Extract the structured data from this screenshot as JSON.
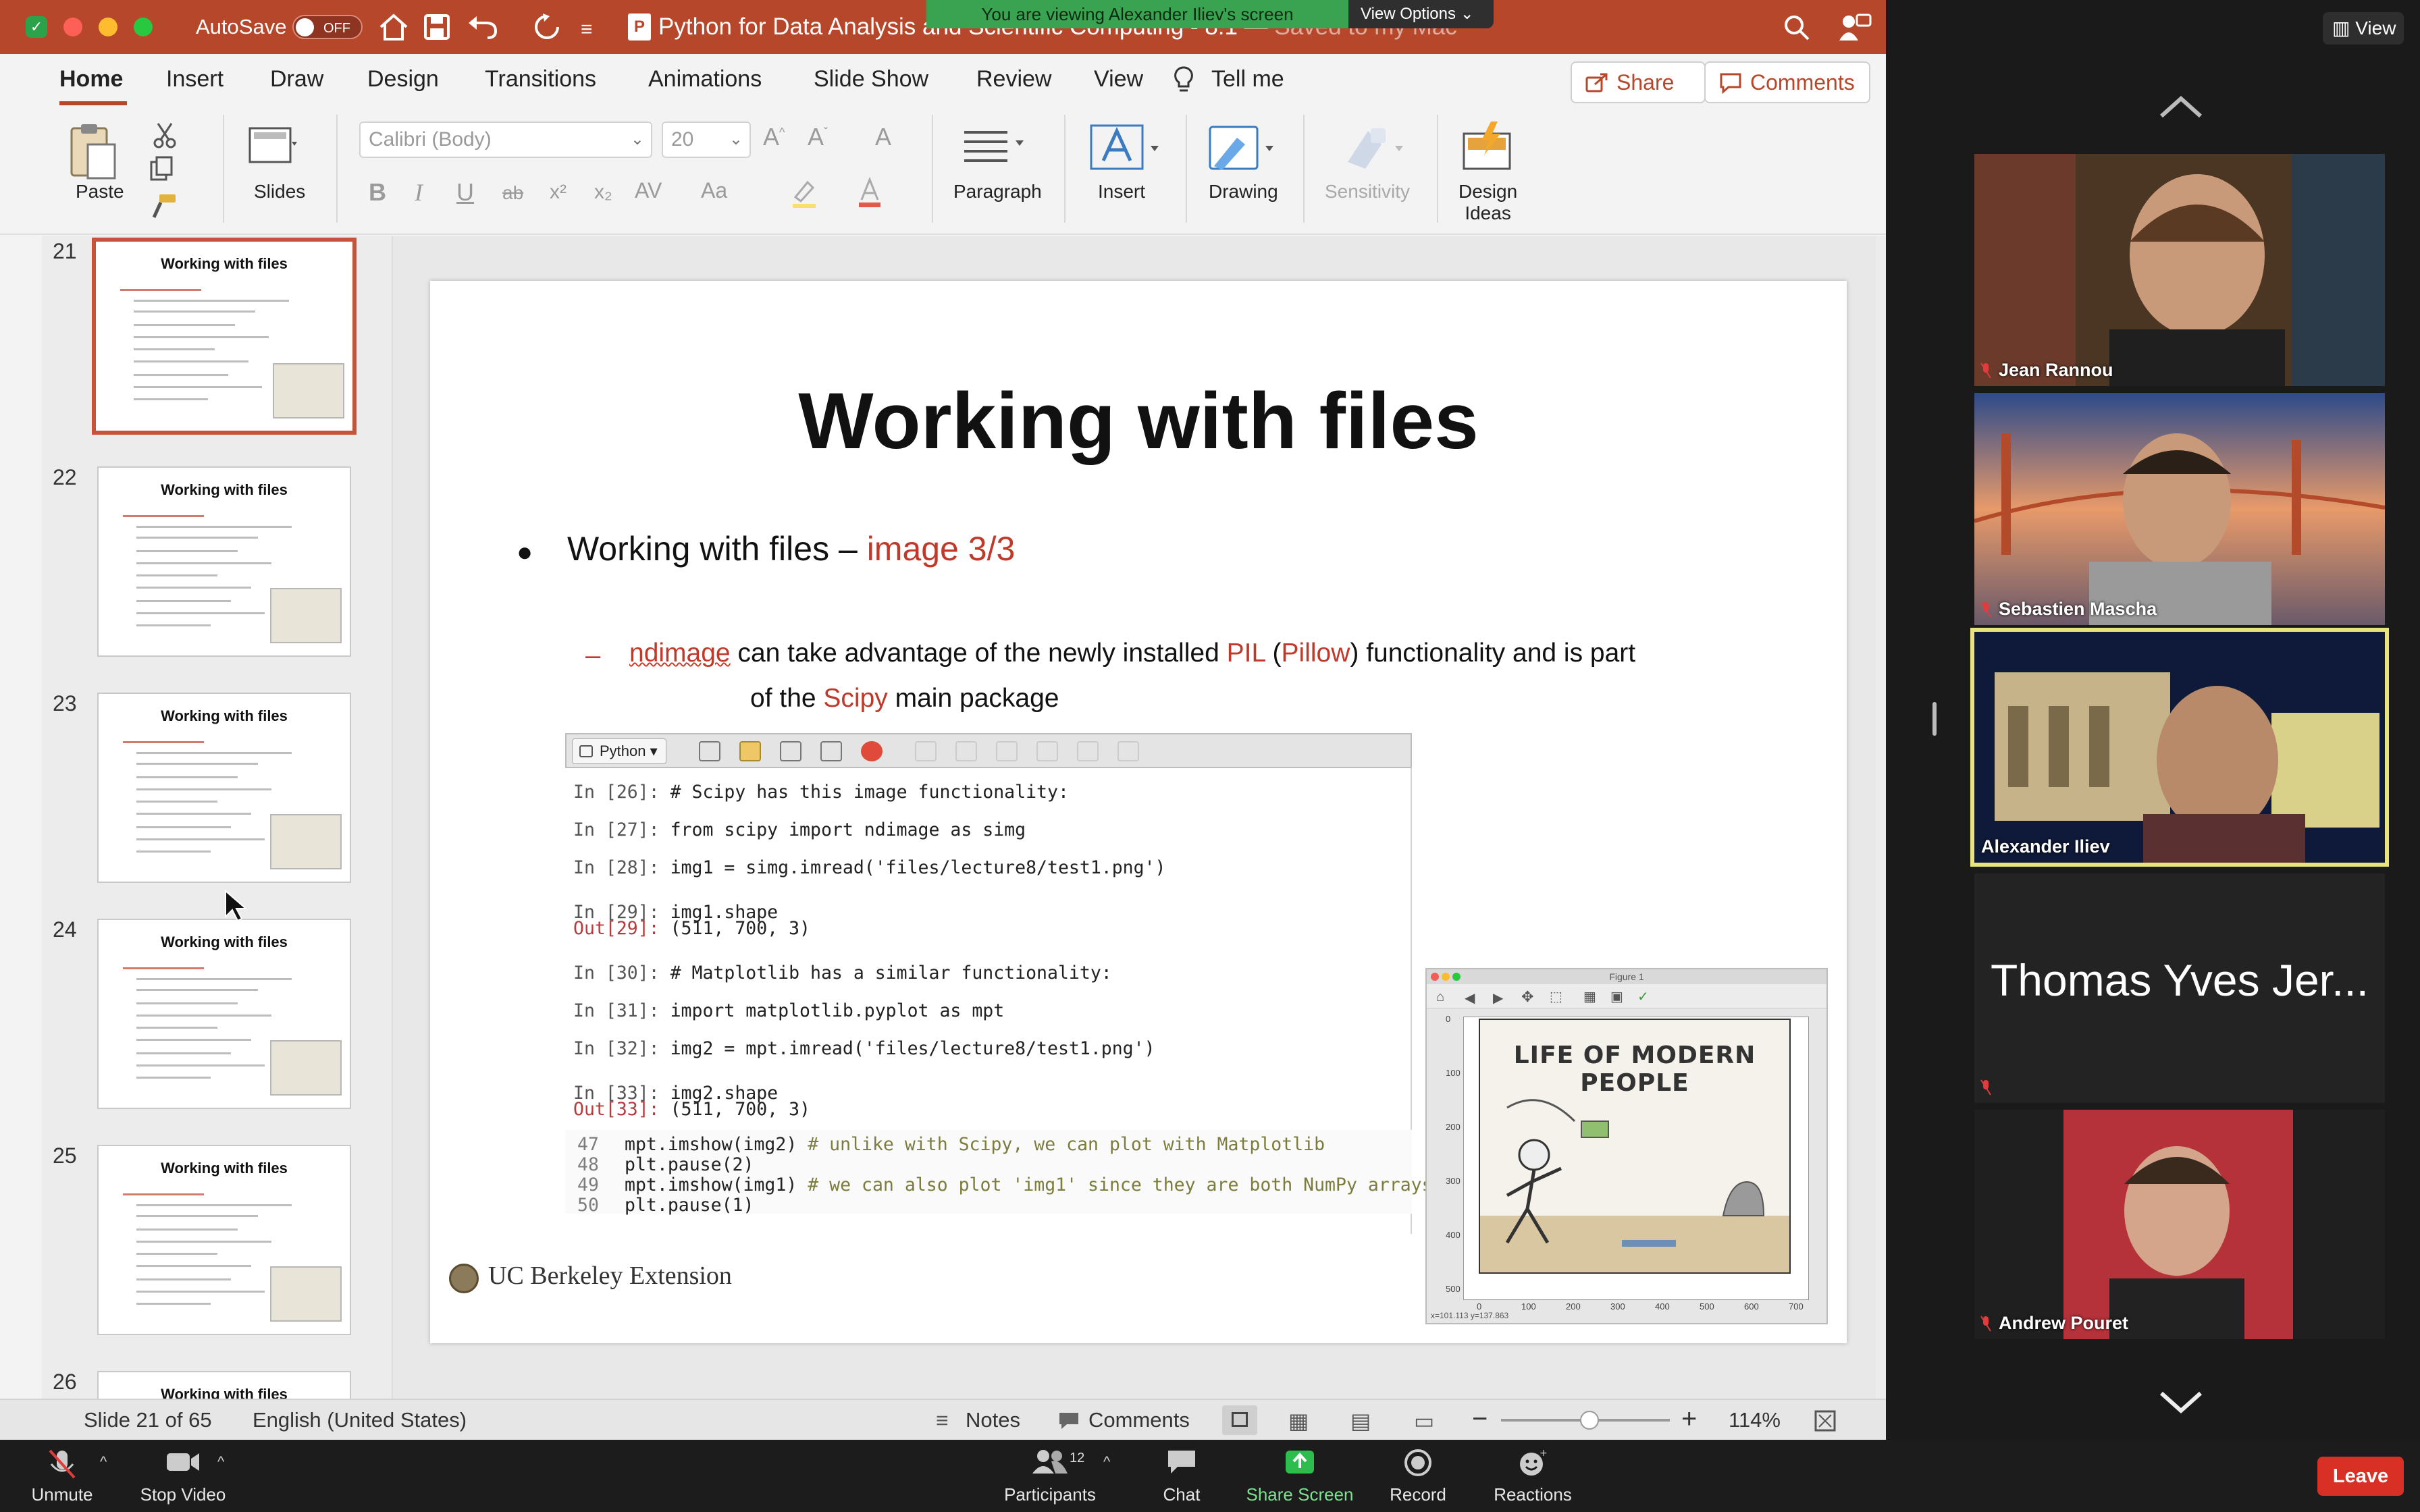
{
  "zoom": {
    "banner_text": "You are viewing Alexander Iliev's screen",
    "view_options_label": "View Options ⌄",
    "view_button_label": "View",
    "participants": [
      {
        "name": "Jean Rannou",
        "muted": true,
        "active": false
      },
      {
        "name": "Sebastien Mascha",
        "muted": true,
        "active": false
      },
      {
        "name": "Alexander Iliev",
        "muted": false,
        "active": true
      },
      {
        "name": "Thomas Yves Jer...",
        "muted": true,
        "active": false,
        "video_off": true
      },
      {
        "name": "Andrew Pouret",
        "muted": true,
        "active": false
      }
    ],
    "toolbar": {
      "unmute_label": "Unmute",
      "stop_video_label": "Stop Video",
      "participants_label": "Participants",
      "participants_count": "12",
      "chat_label": "Chat",
      "share_screen_label": "Share Screen",
      "record_label": "Record",
      "reactions_label": "Reactions",
      "leave_label": "Leave"
    }
  },
  "ppt": {
    "autosave_label": "AutoSave",
    "autosave_state": "OFF",
    "doc_title": "Python for Data Analysis and Scientific Computing - 8.1",
    "save_status": "Saved to my Mac",
    "tabs": [
      "Home",
      "Insert",
      "Draw",
      "Design",
      "Transitions",
      "Animations",
      "Slide Show",
      "Review",
      "View"
    ],
    "tell_me": "Tell me",
    "share_label": "Share",
    "comments_label": "Comments",
    "ribbon": {
      "paste": "Paste",
      "slides": "Slides",
      "font_name": "Calibri (Body)",
      "font_size": "20",
      "paragraph": "Paragraph",
      "insert": "Insert",
      "drawing": "Drawing",
      "sensitivity": "Sensitivity",
      "design_ideas_1": "Design",
      "design_ideas_2": "Ideas",
      "format_buttons": [
        "B",
        "I",
        "U",
        "ab",
        "x²",
        "x₂",
        "AV",
        "Aa"
      ]
    },
    "thumbnails": [
      {
        "num": "21",
        "title": "Working with files",
        "selected": true
      },
      {
        "num": "22",
        "title": "Working with files",
        "selected": false
      },
      {
        "num": "23",
        "title": "Working with files",
        "selected": false
      },
      {
        "num": "24",
        "title": "Working with files",
        "selected": false
      },
      {
        "num": "25",
        "title": "Working with files",
        "selected": false
      },
      {
        "num": "26",
        "title": "Working with files",
        "selected": false
      }
    ],
    "status": {
      "slide_info": "Slide 21 of 65",
      "language": "English (United States)",
      "notes": "Notes",
      "comments": "Comments",
      "zoom_minus": "−",
      "zoom_plus": "+",
      "zoom_level": "114%"
    }
  },
  "slide": {
    "title": "Working with files",
    "bullet_text": "Working with files – ",
    "bullet_highlight": "image 3/3",
    "sub_dash": "–",
    "sub_ndimage": "ndimage",
    "sub_text1": " can take advantage of the newly installed ",
    "sub_pil": "PIL",
    "sub_text2": " (",
    "sub_pillow": "Pillow",
    "sub_text3": ") functionality and is part",
    "sub_line2a": "of the ",
    "sub_scipy": "Scipy",
    "sub_line2b": " main package",
    "console_tab": "Python",
    "console_lines": [
      {
        "prompt": "In [26]: ",
        "code": "# Scipy has this image functionality:"
      },
      {
        "prompt": "In [27]: ",
        "code": "from scipy import ndimage as simg"
      },
      {
        "prompt": "In [28]: ",
        "code": "img1 = simg.imread('files/lecture8/test1.png')"
      },
      {
        "prompt": "In [29]: ",
        "code": "img1.shape"
      },
      {
        "prompt": "Out[29]: ",
        "code": "(511, 700, 3)"
      },
      {
        "prompt": "In [30]: ",
        "code": "# Matplotlib has a similar functionality:"
      },
      {
        "prompt": "In [31]: ",
        "code": "import matplotlib.pyplot as mpt"
      },
      {
        "prompt": "In [32]: ",
        "code": "img2 = mpt.imread('files/lecture8/test1.png')"
      },
      {
        "prompt": "In [33]: ",
        "code": "img2.shape"
      },
      {
        "prompt": "Out[33]: ",
        "code": "(511, 700, 3)"
      }
    ],
    "script_lines": [
      {
        "n": "47",
        "code": "mpt.imshow(img2)",
        "comment": " # unlike with Scipy, we can plot with Matplotlib"
      },
      {
        "n": "48",
        "code": "plt.pause(2)",
        "comment": ""
      },
      {
        "n": "49",
        "code": "mpt.imshow(img1)",
        "comment": " # we can also plot 'img1' since they are both NumPy arrays"
      },
      {
        "n": "50",
        "code": "plt.pause(1)",
        "comment": ""
      }
    ],
    "figure_title": "Figure 1",
    "cartoon_title": "LIFE OF MODERN PEOPLE",
    "y_ticks": [
      "0",
      "100",
      "200",
      "300",
      "400",
      "500"
    ],
    "x_ticks": [
      "0",
      "100",
      "200",
      "300",
      "400",
      "500",
      "600",
      "700"
    ],
    "figure_status": "x=101.113   y=137.863",
    "footer": "UC Berkeley Extension"
  }
}
